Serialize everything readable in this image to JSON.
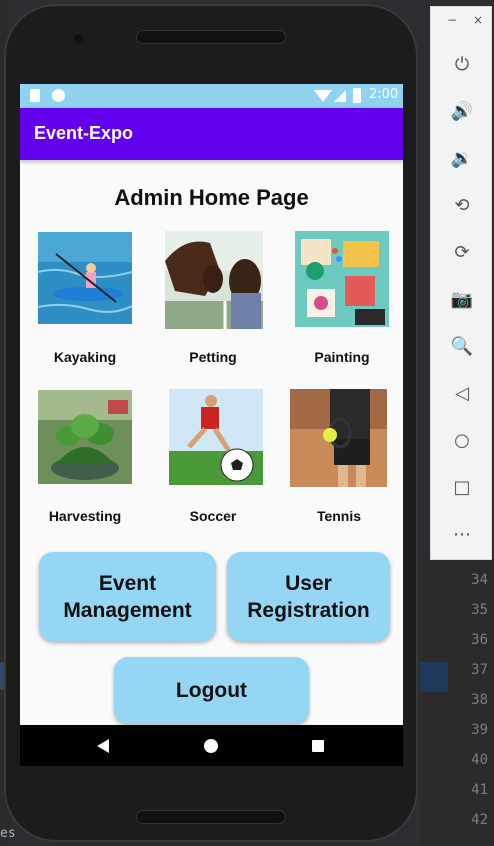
{
  "ide": {
    "left_text": "es",
    "line_numbers": [
      "34",
      "35",
      "36",
      "37",
      "38",
      "39",
      "40",
      "41",
      "42"
    ]
  },
  "emulator_toolbar": {
    "minimize_label": "−",
    "close_label": "×",
    "icons": [
      "power-icon",
      "volume-up-icon",
      "volume-down-icon",
      "rotate-left-icon",
      "rotate-right-icon",
      "camera-icon",
      "zoom-icon",
      "back-icon",
      "home-icon",
      "overview-icon",
      "more-icon"
    ],
    "glyphs": [
      "⏻",
      "🔊",
      "🔉",
      "⟲",
      "⟳",
      "📷",
      "🔍",
      "◁",
      "○",
      "□",
      "⋯"
    ]
  },
  "status_bar": {
    "time": "2:00"
  },
  "app_bar": {
    "title": "Event-Expo"
  },
  "page": {
    "title": "Admin Home Page"
  },
  "activities": [
    {
      "label": "Kayaking"
    },
    {
      "label": "Petting"
    },
    {
      "label": "Painting"
    },
    {
      "label": "Harvesting"
    },
    {
      "label": "Soccer"
    },
    {
      "label": "Tennis"
    }
  ],
  "buttons": {
    "event_management": "Event Management",
    "user_registration": "User Registration",
    "logout": "Logout"
  },
  "colors": {
    "app_bar": "#6200ee",
    "status_bar": "#8fd3f0",
    "button": "#95d6f5"
  }
}
